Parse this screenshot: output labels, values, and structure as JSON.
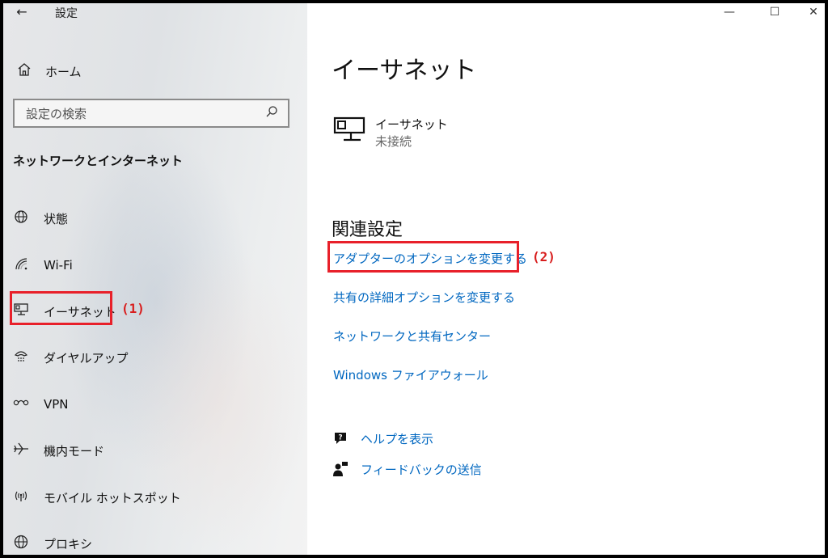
{
  "window": {
    "title": "設定",
    "back_icon": "←",
    "controls": {
      "minimize": "—",
      "maximize": "☐",
      "close": "✕"
    }
  },
  "sidebar": {
    "home_label": "ホーム",
    "search_placeholder": "設定の検索",
    "section_title": "ネットワークとインターネット",
    "items": [
      {
        "label": "状態",
        "icon": "globe-icon"
      },
      {
        "label": "Wi-Fi",
        "icon": "wifi-icon"
      },
      {
        "label": "イーサネット",
        "icon": "ethernet-icon",
        "selected": true
      },
      {
        "label": "ダイヤルアップ",
        "icon": "dialup-icon"
      },
      {
        "label": "VPN",
        "icon": "vpn-icon"
      },
      {
        "label": "機内モード",
        "icon": "airplane-icon"
      },
      {
        "label": "モバイル ホットスポット",
        "icon": "hotspot-icon"
      },
      {
        "label": "プロキシ",
        "icon": "proxy-globe-icon"
      }
    ]
  },
  "main": {
    "title": "イーサネット",
    "adapter": {
      "name": "イーサネット",
      "status": "未接続"
    },
    "related_title": "関連設定",
    "links": [
      "アダプターのオプションを変更する",
      "共有の詳細オプションを変更する",
      "ネットワークと共有センター",
      "Windows ファイアウォール"
    ],
    "help_label": "ヘルプを表示",
    "feedback_label": "フィードバックの送信"
  },
  "annotations": {
    "one": "(1)",
    "two": "(2)",
    "color": "#e8202a"
  },
  "colors": {
    "link": "#0067c0",
    "accent": "#e8202a"
  }
}
